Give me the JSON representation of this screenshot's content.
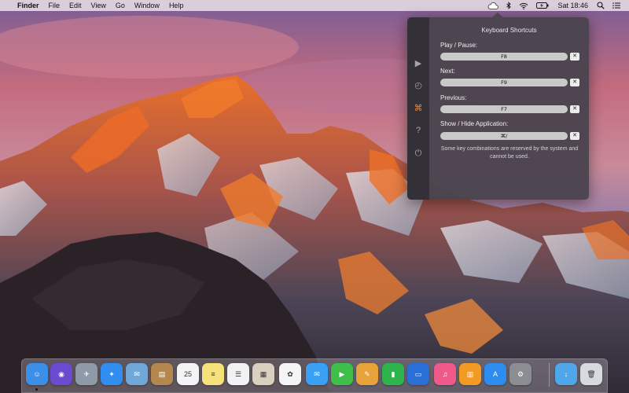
{
  "menubar": {
    "app_name": "Finder",
    "menus": [
      "File",
      "Edit",
      "View",
      "Go",
      "Window",
      "Help"
    ],
    "clock": "Sat 18:46"
  },
  "popover": {
    "title": "Keyboard Shortcuts",
    "shortcuts": [
      {
        "label": "Play / Pause:",
        "value": "F8",
        "clear": "✕"
      },
      {
        "label": "Next:",
        "value": "F9",
        "clear": "✕"
      },
      {
        "label": "Previous:",
        "value": "F7",
        "clear": "✕"
      },
      {
        "label": "Show / Hide Application:",
        "value": "⌘/",
        "clear": "✕"
      }
    ],
    "note": "Some key combinations are reserved by the system and cannot be used.",
    "sidebar": [
      {
        "icon": "play-icon",
        "glyph": "▶",
        "active": false
      },
      {
        "icon": "history-icon",
        "glyph": "◴",
        "active": false
      },
      {
        "icon": "command-key-icon",
        "glyph": "⌘",
        "active": true
      },
      {
        "icon": "help-icon",
        "glyph": "?",
        "active": false
      },
      {
        "icon": "power-icon",
        "glyph": "⏻",
        "active": false
      }
    ],
    "accent_color": "#f08a3a"
  },
  "dock": {
    "apps": [
      {
        "name": "finder-icon",
        "color": "#3b8fe8",
        "glyph": "☺",
        "running": true
      },
      {
        "name": "siri-icon",
        "color": "#6a4bd0",
        "glyph": "◉",
        "running": false
      },
      {
        "name": "launchpad-icon",
        "color": "#8f9aa8",
        "glyph": "✈",
        "running": false
      },
      {
        "name": "safari-icon",
        "color": "#2f8ef0",
        "glyph": "✦",
        "running": false
      },
      {
        "name": "mail-icon",
        "color": "#6fa7d8",
        "glyph": "✉",
        "running": false
      },
      {
        "name": "contacts-icon",
        "color": "#b3874e",
        "glyph": "▤",
        "running": false
      },
      {
        "name": "calendar-icon",
        "color": "#f4f4f4",
        "glyph": "25",
        "running": false
      },
      {
        "name": "notes-icon",
        "color": "#f7e27a",
        "glyph": "≡",
        "running": false
      },
      {
        "name": "reminders-icon",
        "color": "#f2f2f2",
        "glyph": "☰",
        "running": false
      },
      {
        "name": "preview-icon",
        "color": "#d9d0bf",
        "glyph": "▦",
        "running": false
      },
      {
        "name": "photos-icon",
        "color": "#f5f5f5",
        "glyph": "✿",
        "running": false
      },
      {
        "name": "messages-icon",
        "color": "#3aa0f5",
        "glyph": "✉",
        "running": false
      },
      {
        "name": "facetime-icon",
        "color": "#3fbf4a",
        "glyph": "▶",
        "running": false
      },
      {
        "name": "pages-icon",
        "color": "#e8a23a",
        "glyph": "✎",
        "running": false
      },
      {
        "name": "numbers-icon",
        "color": "#2fb34b",
        "glyph": "▮",
        "running": false
      },
      {
        "name": "keynote-icon",
        "color": "#2a6fd6",
        "glyph": "▭",
        "running": false
      },
      {
        "name": "itunes-icon",
        "color": "#f05a8a",
        "glyph": "♫",
        "running": false
      },
      {
        "name": "ibooks-icon",
        "color": "#f39a25",
        "glyph": "▥",
        "running": false
      },
      {
        "name": "app-store-icon",
        "color": "#2d8cf0",
        "glyph": "A",
        "running": false
      },
      {
        "name": "system-preferences-icon",
        "color": "#8a8d92",
        "glyph": "⚙",
        "running": false
      },
      {
        "name": "downloads-folder-icon",
        "color": "#4fa6e8",
        "glyph": "↓",
        "running": false
      },
      {
        "name": "trash-icon",
        "color": "#d7dbe0",
        "glyph": "🗑",
        "running": false
      }
    ]
  }
}
